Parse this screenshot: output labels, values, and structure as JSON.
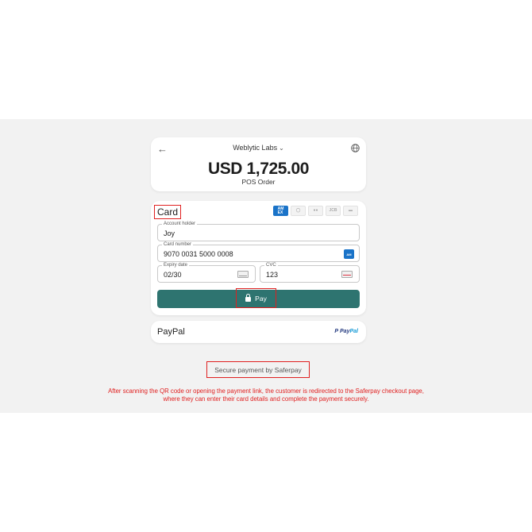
{
  "header": {
    "back_icon": "arrow-left-icon",
    "merchant": "Weblytic Labs",
    "globe_icon": "globe-icon",
    "amount": "USD 1,725.00",
    "order": "POS Order"
  },
  "card_section": {
    "title": "Card",
    "brands": [
      "AMEX",
      "Diners Club",
      "Mastercard",
      "JCB",
      "Card"
    ],
    "holder": {
      "label": "Account holder",
      "value": "Joy"
    },
    "number": {
      "label": "Card number",
      "value": "9070 0031 5000 0008",
      "brand_icon": "AMEX"
    },
    "expiry": {
      "label": "Expiry date",
      "value": "02/30"
    },
    "cvc": {
      "label": "CVC",
      "value": "123"
    },
    "pay_label": "Pay"
  },
  "paypal": {
    "label": "PayPal",
    "logo_pay": "Pay",
    "logo_pal": "Pal"
  },
  "footer": {
    "secure": "Secure payment by Saferpay",
    "note_line1": "After scanning the QR code or opening the payment link, the customer is redirected to the Saferpay checkout page,",
    "note_line2": "where they can enter their card details and complete the payment securely."
  },
  "colors": {
    "accent": "#2e7470",
    "highlight": "#e02020",
    "amex": "#1a73c8"
  }
}
